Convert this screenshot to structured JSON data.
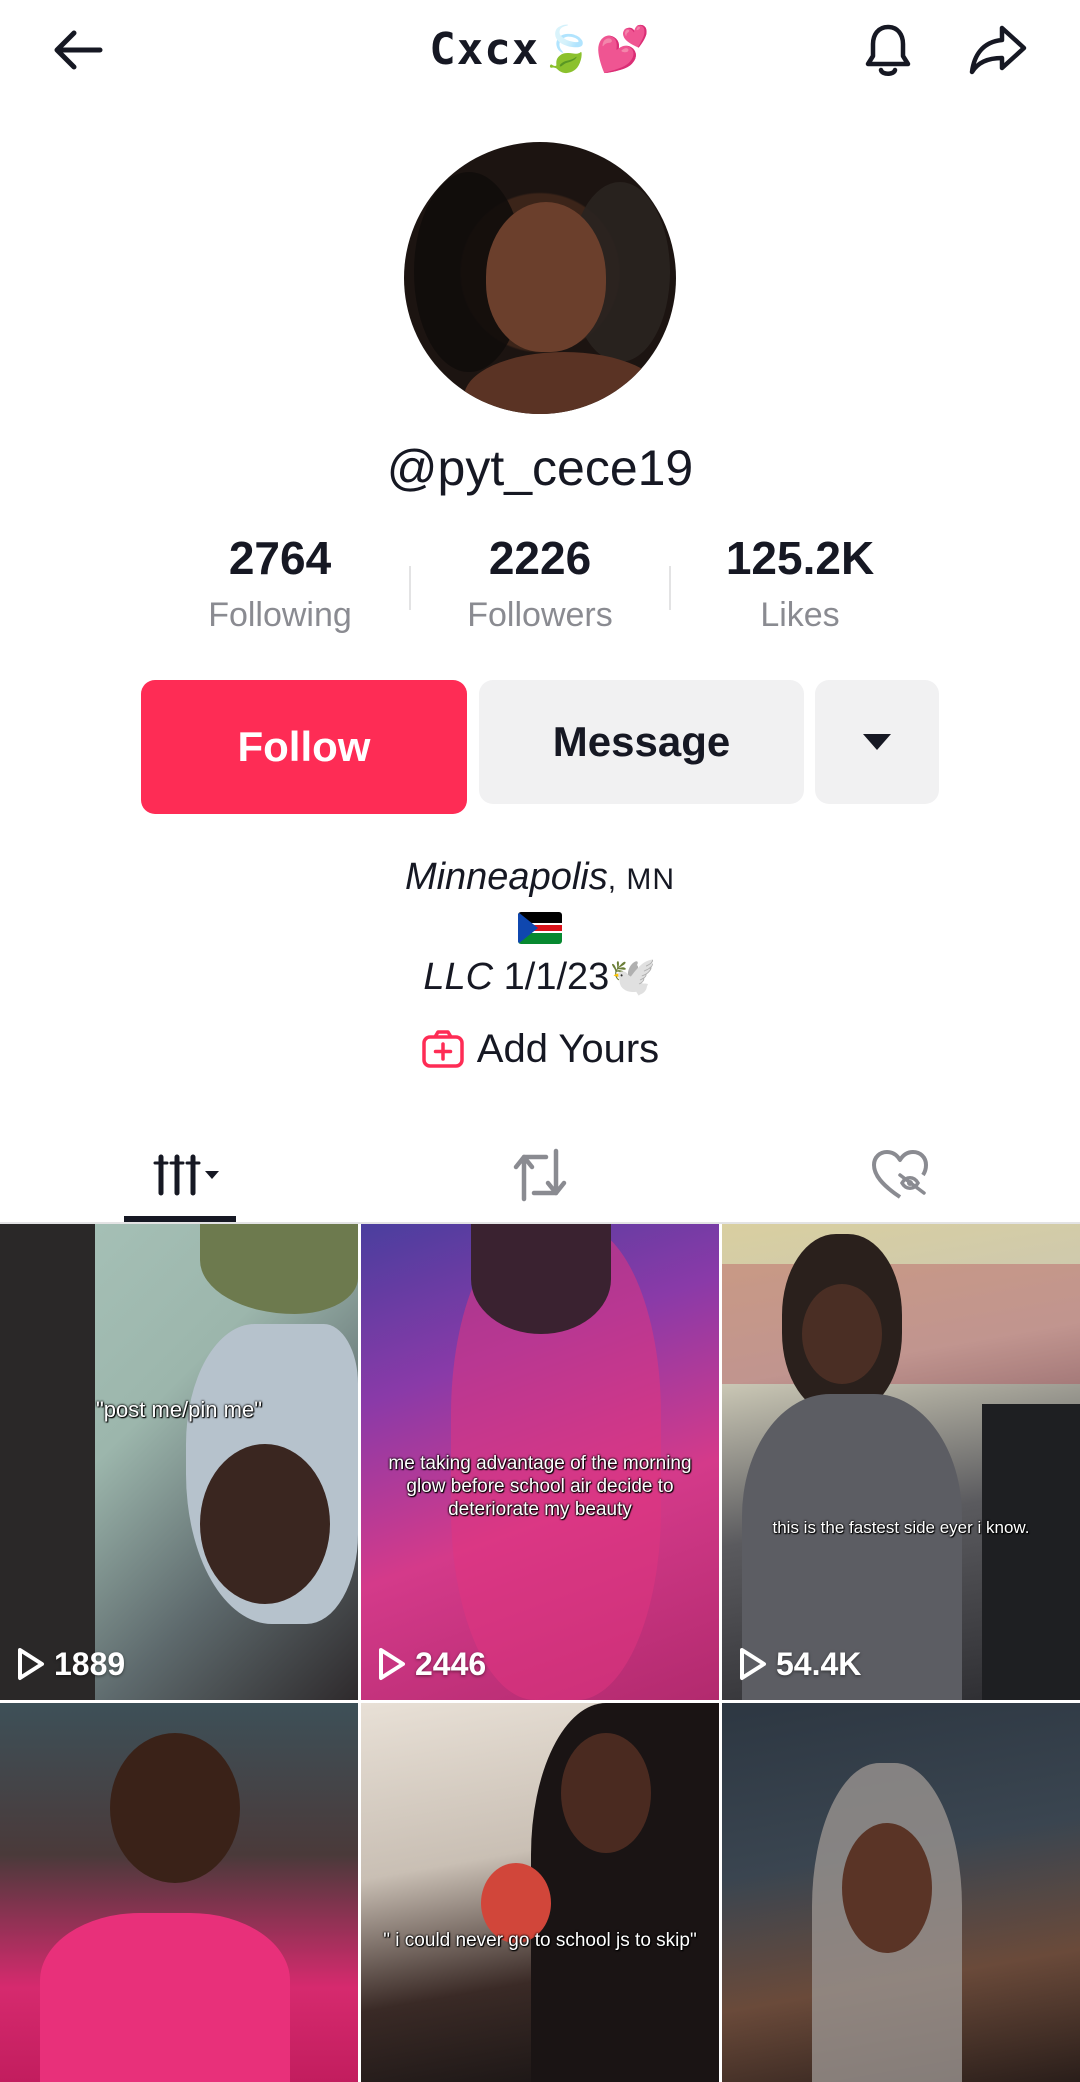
{
  "header": {
    "title": "Cxcx🍃💕"
  },
  "profile": {
    "username": "@pyt_cece19"
  },
  "stats": [
    {
      "value": "2764",
      "label": "Following"
    },
    {
      "value": "2226",
      "label": "Followers"
    },
    {
      "value": "125.2K",
      "label": "Likes"
    }
  ],
  "actions": {
    "follow_label": "Follow",
    "message_label": "Message"
  },
  "bio": {
    "city": "Minneapolis",
    "state": ", MN",
    "llc_prefix": "LLC",
    "llc_rest": " 1/1/23🕊️"
  },
  "add_yours": {
    "label": "Add Yours"
  },
  "colors": {
    "accent": "#fe2c55",
    "text": "#161823",
    "muted": "#8a8b91",
    "button_gray": "#f1f1f2"
  },
  "icons": {
    "back": "arrow-left-icon",
    "bell": "bell-icon",
    "share": "share-arrow-icon",
    "add_yours": "add-yours-icon",
    "videos_tab": "grid-videos-icon",
    "reposts_tab": "repost-icon",
    "liked_tab": "liked-hidden-icon",
    "play": "play-icon"
  },
  "videos": [
    {
      "caption": "\"post me/pin me\"",
      "plays": "1889"
    },
    {
      "caption": "me taking advantage of the morning glow before school air decide to deteriorate my beauty",
      "plays": "2446"
    },
    {
      "caption": "this is the fastest side eyer i know.",
      "plays": "54.4K"
    },
    {
      "caption": "",
      "plays": ""
    },
    {
      "caption": "\" i could never go to school js to skip\"",
      "plays": ""
    },
    {
      "caption": "",
      "plays": ""
    }
  ]
}
